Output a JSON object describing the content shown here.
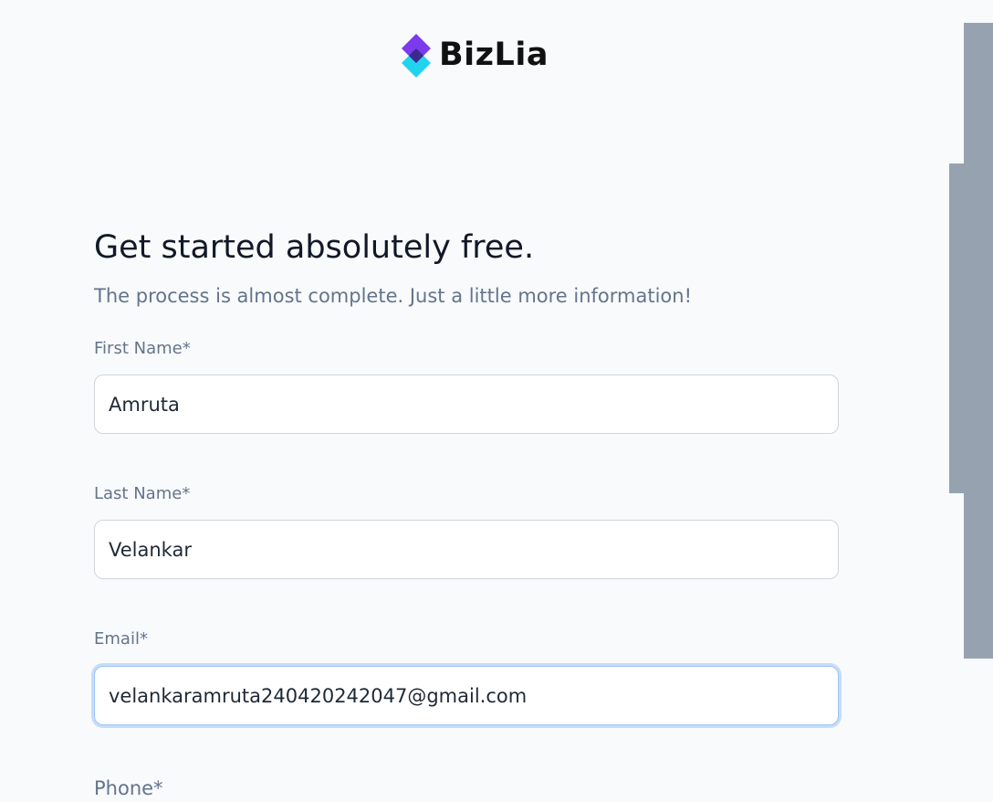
{
  "brand": {
    "name": "BizLia",
    "colors": {
      "top": "#7c3aed",
      "middle": "#3b2a8c",
      "bottom": "#22d3ee"
    }
  },
  "heading": {
    "title": "Get started absolutely free.",
    "subtitle": "The process is almost complete. Just a little more information!"
  },
  "form": {
    "first_name": {
      "label": "First Name*",
      "value": "Amruta"
    },
    "last_name": {
      "label": "Last Name*",
      "value": "Velankar"
    },
    "email": {
      "label": "Email*",
      "value": "velankaramruta240420242047@gmail.com",
      "focused": true
    },
    "phone": {
      "label": "Phone*"
    }
  },
  "colors": {
    "page_background": "#f8fafc",
    "side_panel": "#97a2b1",
    "focus_ring": "#c5dcfa"
  }
}
